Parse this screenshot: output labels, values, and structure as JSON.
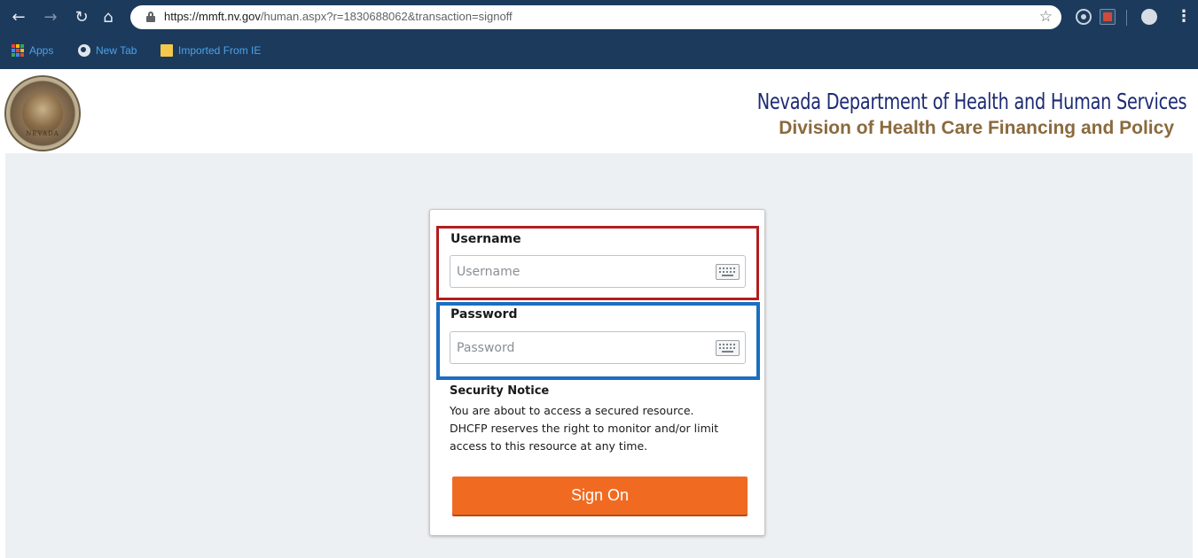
{
  "browser": {
    "url_host": "https://mmft.nv.gov",
    "url_rest": "/human.aspx?r=1830688062&transaction=signoff",
    "icons": {
      "back": "back-arrow-icon",
      "forward": "forward-arrow-icon",
      "reload": "reload-icon",
      "home": "home-icon",
      "lock": "lock-icon",
      "star": "star-icon",
      "menu": "kebab-menu-icon"
    },
    "bookmarks": [
      {
        "label": "Apps",
        "icon": "apps-grid-icon"
      },
      {
        "label": "New Tab",
        "icon": "globe-icon"
      },
      {
        "label": "Imported From IE",
        "icon": "folder-icon"
      }
    ]
  },
  "header": {
    "department": "Nevada Department of Health and Human Services",
    "division": "Division of Health Care Financing and Policy",
    "seal_text": "NEVADA"
  },
  "login": {
    "username_label": "Username",
    "username_placeholder": "Username",
    "username_value": "",
    "password_label": "Password",
    "password_placeholder": "Password",
    "password_value": "",
    "notice_title": "Security Notice",
    "notice_line1": "You are about to access a secured resource.",
    "notice_line2": "DHCFP reserves the right to monitor and/or limit",
    "notice_line3": "access to this resource at any time.",
    "signon_label": "Sign On"
  },
  "colors": {
    "chrome_bg": "#1c3a5c",
    "page_bg": "#edf0f2",
    "department_title": "#1d2a73",
    "division_title": "#8a6a3e",
    "signon_button": "#f06b21",
    "highlight_username": "#b11f1f",
    "highlight_password": "#1b6fc0"
  }
}
